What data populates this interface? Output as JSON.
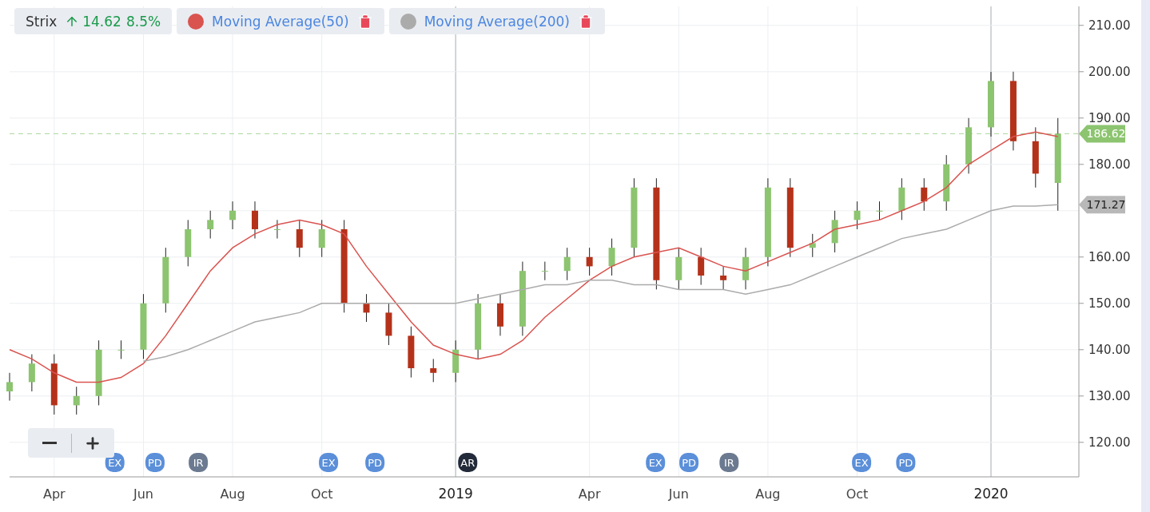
{
  "legend": {
    "symbol": "Strix",
    "change": "14.62",
    "change_percent": "8.5%"
  },
  "last_price_tag": "186.62",
  "ma200_tag": "171.27",
  "event_markers": [
    {
      "color": "#5b8fd9"
    },
    {
      "color": "#5b8fd9"
    },
    {
      "color": "#6b7a90"
    },
    {
      "color": "#5b8fd9"
    },
    {
      "color": "#5b8fd9"
    },
    {
      "color": "#232b3a"
    },
    {
      "color": "#5b8fd9"
    },
    {
      "color": "#5b8fd9"
    },
    {
      "color": "#6b7a90"
    },
    {
      "color": "#5b8fd9"
    },
    {
      "color": "#5b8fd9"
    }
  ],
  "chart_data": {
    "type": "candlestick",
    "grid": true,
    "x": [
      2018.1667,
      2018.2083,
      2018.25,
      2018.2917,
      2018.3333,
      2018.375,
      2018.4167,
      2018.4583,
      2018.5,
      2018.5417,
      2018.5833,
      2018.625,
      2018.6667,
      2018.7083,
      2018.75,
      2018.7917,
      2018.8333,
      2018.875,
      2018.9167,
      2018.9583,
      2019,
      2019.0417,
      2019.0833,
      2019.125,
      2019.1667,
      2019.2083,
      2019.25,
      2019.2917,
      2019.3333,
      2019.375,
      2019.4167,
      2019.4583,
      2019.5,
      2019.5417,
      2019.5833,
      2019.625,
      2019.6667,
      2019.7083,
      2019.75,
      2019.7917,
      2019.8333,
      2019.875,
      2019.9167,
      2019.9583,
      2020,
      2020.0417,
      2020.0833,
      2020.125
    ],
    "xlim": [
      2018.1667,
      2020.1642
    ],
    "ylim": [
      112.55,
      214.1
    ],
    "xticks": [
      {
        "value": 2018.25,
        "label": "Apr"
      },
      {
        "value": 2018.4167,
        "label": "Jun"
      },
      {
        "value": 2018.5833,
        "label": "Aug"
      },
      {
        "value": 2018.75,
        "label": "Oct"
      },
      {
        "value": 2019,
        "label": "2019"
      },
      {
        "value": 2019.25,
        "label": "Apr"
      },
      {
        "value": 2019.4167,
        "label": "Jun"
      },
      {
        "value": 2019.5833,
        "label": "Aug"
      },
      {
        "value": 2019.75,
        "label": "Oct"
      },
      {
        "value": 2020,
        "label": "2020"
      }
    ],
    "yticks": [
      {
        "value": 120,
        "label": "120.00"
      },
      {
        "value": 130,
        "label": "130.00"
      },
      {
        "value": 140,
        "label": "140.00"
      },
      {
        "value": 150,
        "label": "150.00"
      },
      {
        "value": 160,
        "label": "160.00"
      },
      {
        "value": 180,
        "label": "180.00"
      },
      {
        "value": 190,
        "label": "190.00"
      },
      {
        "value": 200,
        "label": "200.00"
      },
      {
        "value": 210,
        "label": "210.00"
      }
    ],
    "ohlc": [
      [
        131,
        135,
        129,
        133
      ],
      [
        133,
        139,
        131,
        137
      ],
      [
        137,
        139,
        126,
        128
      ],
      [
        128,
        132,
        126,
        130
      ],
      [
        130,
        142,
        128,
        140
      ],
      [
        140,
        142,
        138,
        140
      ],
      [
        140,
        152,
        138,
        150
      ],
      [
        150,
        162,
        148,
        160
      ],
      [
        160,
        168,
        158,
        166
      ],
      [
        166,
        170,
        164,
        168
      ],
      [
        168,
        172,
        166,
        170
      ],
      [
        170,
        172,
        164,
        166
      ],
      [
        166,
        168,
        164,
        166
      ],
      [
        166,
        168,
        160,
        162
      ],
      [
        162,
        168,
        160,
        166
      ],
      [
        166,
        168,
        148,
        150
      ],
      [
        150,
        152,
        146,
        148
      ],
      [
        148,
        150,
        141,
        143
      ],
      [
        143,
        145,
        134,
        136
      ],
      [
        136,
        138,
        133,
        135
      ],
      [
        135,
        142,
        133,
        140
      ],
      [
        140,
        152,
        138,
        150
      ],
      [
        150,
        152,
        143,
        145
      ],
      [
        145,
        159,
        143,
        157
      ],
      [
        157,
        159,
        155,
        157
      ],
      [
        157,
        162,
        155,
        160
      ],
      [
        160,
        162,
        156,
        158
      ],
      [
        158,
        164,
        156,
        162
      ],
      [
        162,
        177,
        160,
        175
      ],
      [
        175,
        177,
        153,
        155
      ],
      [
        155,
        162,
        153,
        160
      ],
      [
        160,
        162,
        154,
        156
      ],
      [
        156,
        158,
        153,
        155
      ],
      [
        155,
        162,
        153,
        160
      ],
      [
        160,
        177,
        158,
        175
      ],
      [
        175,
        177,
        160,
        162
      ],
      [
        162,
        165,
        160,
        163
      ],
      [
        163,
        170,
        161,
        168
      ],
      [
        168,
        172,
        166,
        170
      ],
      [
        170,
        172,
        168,
        170
      ],
      [
        170,
        177,
        168,
        175
      ],
      [
        175,
        177,
        170,
        172
      ],
      [
        172,
        182,
        170,
        180
      ],
      [
        180,
        190,
        178,
        188
      ],
      [
        188,
        200,
        186,
        198
      ],
      [
        198,
        200,
        183,
        185
      ],
      [
        185,
        188,
        175,
        178
      ],
      [
        176,
        190,
        170,
        186.62
      ]
    ],
    "series": [
      {
        "name": "Moving Average(50)",
        "type": "line",
        "color": "#d9534f",
        "values": [
          140,
          138,
          135,
          133,
          133,
          134,
          137,
          143,
          150,
          157,
          162,
          165,
          167,
          168,
          167,
          165,
          158,
          152,
          146,
          141,
          139,
          138,
          139,
          142,
          147,
          151,
          155,
          158,
          160,
          161,
          162,
          160,
          158,
          157,
          159,
          161,
          163,
          166,
          167,
          168,
          170,
          172,
          175,
          180,
          183,
          186,
          187,
          186
        ]
      },
      {
        "name": "Moving Average(200)",
        "type": "line",
        "color": "#ababab",
        "values": [
          null,
          null,
          null,
          null,
          null,
          null,
          137.5,
          138.5,
          140,
          142,
          144,
          146,
          147,
          148,
          150,
          150,
          150,
          150,
          150,
          150,
          150,
          151,
          152,
          153,
          154,
          154,
          155,
          155,
          154,
          154,
          153,
          153,
          153,
          152,
          153,
          154,
          156,
          158,
          160,
          162,
          164,
          165,
          166,
          168,
          170,
          171,
          171,
          171.3
        ]
      }
    ],
    "ref_lines": [
      {
        "axis": "y",
        "value": 186.62
      }
    ],
    "annotations": [
      {
        "x": 2018.3633,
        "text": "EX"
      },
      {
        "x": 2018.4383,
        "text": "PD"
      },
      {
        "x": 2018.5192,
        "text": "IR"
      },
      {
        "x": 2018.7625,
        "text": "EX"
      },
      {
        "x": 2018.8492,
        "text": "PD"
      },
      {
        "x": 2019.0225,
        "text": "AR"
      },
      {
        "x": 2019.3733,
        "text": "EX"
      },
      {
        "x": 2019.4358,
        "text": "PD"
      },
      {
        "x": 2019.5108,
        "text": "IR"
      },
      {
        "x": 2019.7583,
        "text": "EX"
      },
      {
        "x": 2019.8408,
        "text": "PD"
      }
    ]
  }
}
